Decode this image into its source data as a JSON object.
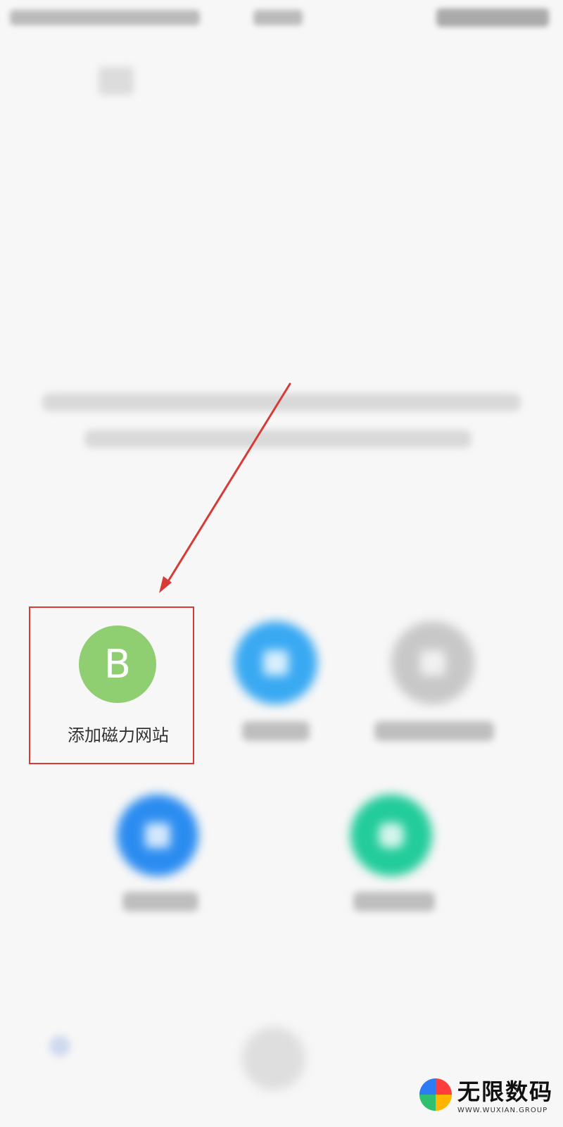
{
  "highlight": {
    "icon_letter": "B",
    "label": "添加磁力网站"
  },
  "colors": {
    "highlight_icon": "#8fcf72",
    "highlight_border": "#d83a35",
    "arrow": "#d83a35",
    "grid_icon": "#39a9f2",
    "blue_icon": "#2b8cf0",
    "green_icon": "#23cc9b"
  },
  "icons": [
    "letter-b-icon",
    "grid-icon",
    "gray-icon",
    "blue-edit-icon",
    "green-cloud-icon"
  ],
  "watermark": {
    "title": "无限数码",
    "subtitle": "WWW.WUXIAN.GROUP"
  }
}
